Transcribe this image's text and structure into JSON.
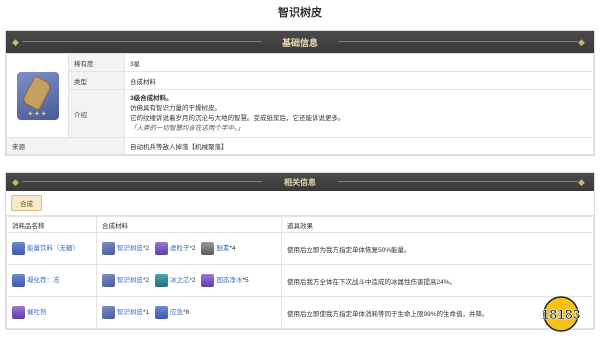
{
  "page": {
    "title": "智识树皮"
  },
  "basic": {
    "header": "基础信息",
    "rows": {
      "rarity": {
        "label": "稀有度",
        "value": "3星"
      },
      "type": {
        "label": "类型",
        "value": "合成材料"
      },
      "intro": {
        "label": "介绍",
        "bold": "3级合成材料。",
        "line1": "仿佛具有智识力量的干燥树皮。",
        "line2": "它的纹缕诉说着岁月的沉沦与大地的智慧。变成纸浆后，它还能诉说更多。",
        "quote": "「人类的一切智慧均含在这两个字中。」"
      },
      "source": {
        "label": "来源",
        "value": "自动机兵等敌人掉落【机械聚落】"
      }
    },
    "stars": "✦✦✦"
  },
  "related": {
    "header": "相关信息",
    "tab": "合成",
    "columns": [
      "消耗品名称",
      "合成材料",
      "道具效果"
    ],
    "rows": [
      {
        "name": "能量饮料（无糖）",
        "materials": [
          {
            "name": "智识树皮",
            "qty": "*2"
          },
          {
            "name": "虚粒子",
            "qty": "*2"
          },
          {
            "name": "醚素",
            "qty": "*4"
          }
        ],
        "effect": "使用后立即为我方指定单体恢复50%能量。"
      },
      {
        "name": "凝化荐：冻",
        "materials": [
          {
            "name": "智识树皮",
            "qty": "*2"
          },
          {
            "name": "冰之芯",
            "qty": "*2"
          },
          {
            "name": "固态净水",
            "qty": "*5"
          }
        ],
        "effect": "使用后我方全体在下次战斗中造成的冰属性伤害提高24%。"
      },
      {
        "name": "催吐剂",
        "materials": [
          {
            "name": "智识树皮",
            "qty": "*1"
          },
          {
            "name": "应急",
            "qty": "*8"
          }
        ],
        "effect": "使用后立即使我方指定单体消耗等同于生命上限99%的生命值，并降。"
      }
    ]
  },
  "watermark": {
    "text": "18183"
  },
  "colors": {
    "accent": "#e8d9b0",
    "bar": "#3a3a3a",
    "link": "#3a6ec8",
    "tab": "#f6e9c9"
  }
}
